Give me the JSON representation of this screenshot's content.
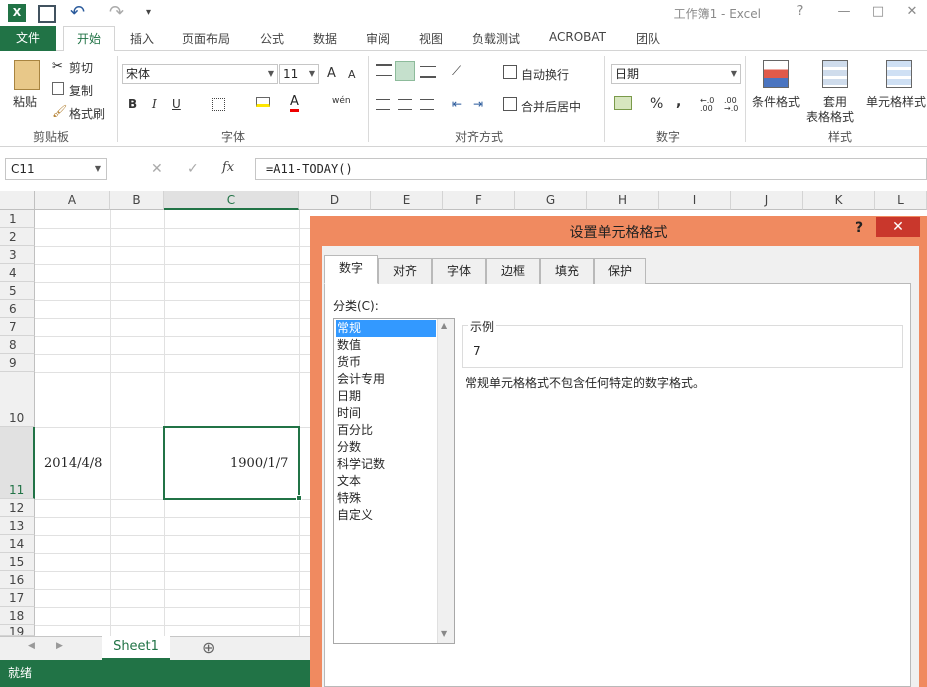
{
  "window": {
    "title": "工作簿1 - Excel",
    "help": "?",
    "minimize": "—",
    "restore": "□",
    "close": "✕"
  },
  "qat": {
    "undo": "↶",
    "redo": "↷",
    "more": "▾"
  },
  "tabs": {
    "file": "文件",
    "home": "开始",
    "insert": "插入",
    "layout": "页面布局",
    "formulas": "公式",
    "data": "数据",
    "review": "审阅",
    "view": "视图",
    "loadtest": "负载测试",
    "acrobat": "ACROBAT",
    "team": "团队"
  },
  "ribbon": {
    "clipboard": {
      "paste": "粘贴",
      "cut": "剪切",
      "copy": "复制",
      "painter": "格式刷",
      "group": "剪贴板"
    },
    "font": {
      "name": "宋体",
      "size": "11",
      "grow": "A",
      "shrink": "A",
      "bold": "B",
      "italic": "I",
      "underline": "U",
      "group": "字体",
      "phonetic": "wén"
    },
    "alignment": {
      "wrap": "自动换行",
      "merge": "合并后居中",
      "group": "对齐方式"
    },
    "number": {
      "format": "日期",
      "percent": "%",
      "comma": ",",
      "group": "数字"
    },
    "styles": {
      "conditional": "条件格式",
      "table1": "套用",
      "table2": "表格格式",
      "cellstyles": "单元格样式",
      "group": "样式"
    }
  },
  "formula_bar": {
    "namebox": "C11",
    "cancel": "✕",
    "enter": "✓",
    "fx": "fx",
    "formula": "=A11-TODAY()"
  },
  "grid": {
    "columns": [
      "A",
      "B",
      "C",
      "D",
      "E",
      "F",
      "G",
      "H",
      "I",
      "J",
      "K",
      "L"
    ],
    "rows": [
      "1",
      "2",
      "3",
      "4",
      "5",
      "6",
      "7",
      "8",
      "9",
      "10",
      "11",
      "12",
      "13",
      "14",
      "15",
      "16",
      "17",
      "18",
      "19"
    ],
    "cells": {
      "A11": "2014/4/8",
      "C11": "1900/1/7"
    }
  },
  "sheets": {
    "active": "Sheet1",
    "add": "⊕"
  },
  "status": {
    "text": "就绪"
  },
  "dialog": {
    "title": "设置单元格格式",
    "tabs": [
      "数字",
      "对齐",
      "字体",
      "边框",
      "填充",
      "保护"
    ],
    "category_label": "分类(C):",
    "categories": [
      "常规",
      "数值",
      "货币",
      "会计专用",
      "日期",
      "时间",
      "百分比",
      "分数",
      "科学记数",
      "文本",
      "特殊",
      "自定义"
    ],
    "selected": "常规",
    "sample_label": "示例",
    "sample_value": "7",
    "description": "常规单元格格式不包含任何特定的数字格式。"
  },
  "colors": {
    "excel_green": "#217346",
    "dialog_border": "#f08a60",
    "selection": "#3399ff",
    "close_red": "#c9372c"
  }
}
